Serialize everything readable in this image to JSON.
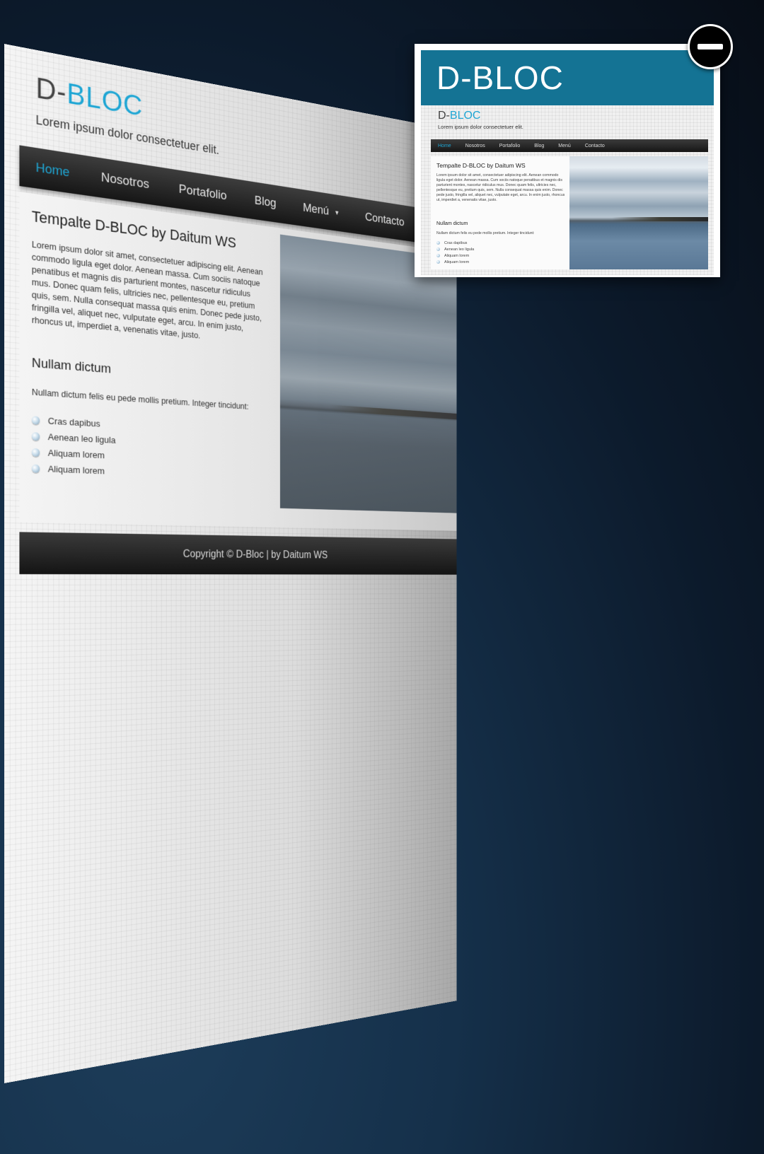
{
  "preview": {
    "brand_prefix": "D-",
    "brand_accent": "BLOC",
    "tagline": "Lorem ipsum dolor consectetuer elit.",
    "nav": [
      {
        "label": "Home",
        "active": true
      },
      {
        "label": "Nosotros",
        "active": false
      },
      {
        "label": "Portafolio",
        "active": false
      },
      {
        "label": "Blog",
        "active": false
      },
      {
        "label": "Menú",
        "active": false,
        "has_dropdown": true
      },
      {
        "label": "Contacto",
        "active": false
      }
    ],
    "content": {
      "title": "Tempalte D-BLOC by Daitum WS",
      "lead": "Lorem ipsum dolor sit amet, consectetuer adipiscing elit. Aenean commodo ligula eget dolor. Aenean massa. Cum sociis natoque penatibus et magnis dis parturient montes, nascetur ridiculus mus. Donec quam felis, ultricies nec, pellentesque eu, pretium quis, sem. Nulla consequat massa quis enim. Donec pede justo, fringilla vel, aliquet nec, vulputate eget, arcu. In enim justo, rhoncus ut, imperdiet a, venenatis vitae, justo.",
      "subheading": "Nullam dictum",
      "subtext": "Nullam dictum felis eu pede mollis pretium. Integer tincidunt:",
      "list": [
        "Cras dapibus",
        "Aenean leo ligula",
        "Aliquam lorem",
        "Aliquam lorem"
      ]
    },
    "footer": "Copyright © D-Bloc | by Daitum WS"
  },
  "thumbnail": {
    "title": "D-BLOC",
    "header_color": "#147394",
    "close_icon": "minus-circle-icon"
  },
  "colors": {
    "accent": "#1fa6d4",
    "nav_bg": "#1e1e1e",
    "backdrop": "#0c1a2b"
  }
}
